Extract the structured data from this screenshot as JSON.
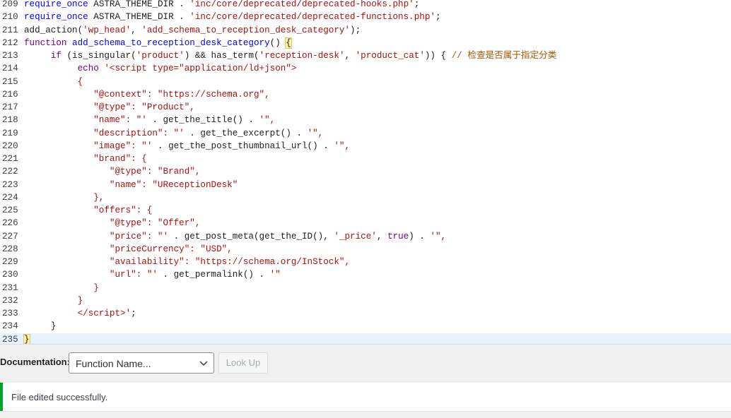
{
  "editor": {
    "lines": [
      {
        "num": "209",
        "html": "<span class=\"fn\">require_once</span> ASTRA_THEME_DIR . <span class=\"str\">'inc/core/deprecated/deprecated-hooks.php'</span>;"
      },
      {
        "num": "210",
        "html": "<span class=\"fn\">require_once</span> ASTRA_THEME_DIR . <span class=\"str\">'inc/core/deprecated/deprecated-functions.php'</span>;"
      },
      {
        "num": "211",
        "html": "add_action(<span class=\"str\">'wp_head'</span>, <span class=\"str\">'add_schema_to_reception_desk_category'</span>);"
      },
      {
        "num": "212",
        "html": "<span class=\"kw\">function</span> <span class=\"fn\">add_schema_to_reception_desk_category</span>() <span class=\"bracket-hl\">{</span>"
      },
      {
        "num": "213",
        "html": "     <span class=\"kw\">if</span> (is_singular(<span class=\"str\">'product'</span>) &amp;&amp; has_term(<span class=\"str\">'reception-desk'</span>, <span class=\"str\">'product_cat'</span>)) { <span class=\"cm\">// 检查是否属于指定分类</span>"
      },
      {
        "num": "214",
        "html": "          <span class=\"kw\">echo</span> <span class=\"str\">'&lt;script type=\"application/ld+json\"&gt;</span>"
      },
      {
        "num": "215",
        "html": "<span class=\"str\">          {</span>"
      },
      {
        "num": "216",
        "html": "<span class=\"str\">             \"@context\": \"https://schema.org\",</span>"
      },
      {
        "num": "217",
        "html": "<span class=\"str\">             \"@type\": \"Product\",</span>"
      },
      {
        "num": "218",
        "html": "<span class=\"str\">             \"name\": \"'</span> . get_the_title() . <span class=\"str\">'\",</span>"
      },
      {
        "num": "219",
        "html": "<span class=\"str\">             \"description\": \"'</span> . get_the_excerpt() . <span class=\"str\">'\",</span>"
      },
      {
        "num": "220",
        "html": "<span class=\"str\">             \"image\": \"'</span> . get_the_post_thumbnail_url() . <span class=\"str\">'\",</span>"
      },
      {
        "num": "221",
        "html": "<span class=\"str\">             \"brand\": {</span>"
      },
      {
        "num": "222",
        "html": "<span class=\"str\">                \"@type\": \"Brand\",</span>"
      },
      {
        "num": "223",
        "html": "<span class=\"str\">                \"name\": \"UReceptionDesk\"</span>"
      },
      {
        "num": "224",
        "html": "<span class=\"str\">             },</span>"
      },
      {
        "num": "225",
        "html": "<span class=\"str\">             \"offers\": {</span>"
      },
      {
        "num": "226",
        "html": "<span class=\"str\">                \"@type\": \"Offer\",</span>"
      },
      {
        "num": "227",
        "html": "<span class=\"str\">                \"price\": \"'</span> . get_post_meta(get_the_ID(), <span class=\"str\">'_price'</span>, <span class=\"kw\">true</span>) . <span class=\"str\">'\",</span>"
      },
      {
        "num": "228",
        "html": "<span class=\"str\">                \"priceCurrency\": \"USD\",</span>"
      },
      {
        "num": "229",
        "html": "<span class=\"str\">                \"availability\": \"https://schema.org/InStock\",</span>"
      },
      {
        "num": "230",
        "html": "<span class=\"str\">                \"url\": \"'</span> . get_permalink() . <span class=\"str\">'\"</span>"
      },
      {
        "num": "231",
        "html": "<span class=\"str\">             }</span>"
      },
      {
        "num": "232",
        "html": "<span class=\"str\">          }</span>"
      },
      {
        "num": "233",
        "html": "<span class=\"str\">          &lt;/script&gt;'</span>;"
      },
      {
        "num": "234",
        "html": "     }"
      },
      {
        "num": "235",
        "html": "<span class=\"bracket-hl\">}</span>",
        "active": true
      }
    ]
  },
  "documentation": {
    "label": "Documentation:",
    "select_value": "Function Name...",
    "lookup_label": "Look Up"
  },
  "notice": {
    "text": "File edited successfully.",
    "color": "#00a32a"
  }
}
